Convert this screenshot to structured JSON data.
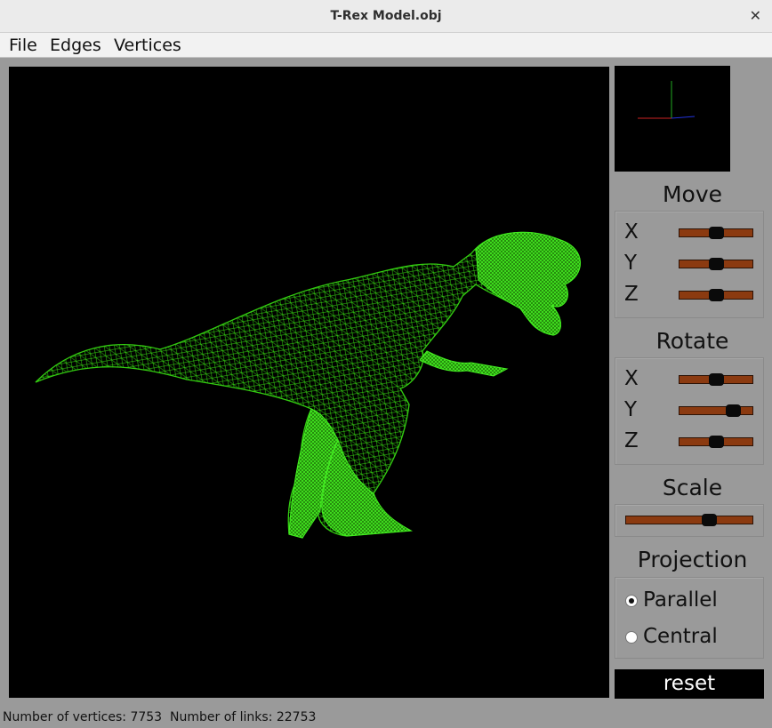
{
  "window": {
    "title": "T-Rex Model.obj",
    "close_glyph": "✕"
  },
  "menu": {
    "file": "File",
    "edges": "Edges",
    "vertices": "Vertices"
  },
  "colors": {
    "wireframe": "#33cc11",
    "slider_track": "#8b3a10",
    "axis_x": "#cc2222",
    "axis_y": "#22aa22",
    "axis_z": "#2233dd"
  },
  "move": {
    "title": "Move",
    "x": "X",
    "y": "Y",
    "z": "Z",
    "x_level": 0.5,
    "y_level": 0.5,
    "z_level": 0.5
  },
  "rotate": {
    "title": "Rotate",
    "x": "X",
    "y": "Y",
    "z": "Z",
    "x_level": 0.5,
    "y_level": 0.8,
    "z_level": 0.5
  },
  "scale": {
    "title": "Scale",
    "level": 0.68
  },
  "projection": {
    "title": "Projection",
    "parallel": "Parallel",
    "central": "Central",
    "selected": "parallel"
  },
  "reset_label": "reset",
  "status": {
    "vertices_label": "Number of vertices:",
    "vertices": "7753",
    "links_label": "Number of links:",
    "links": "22753"
  }
}
